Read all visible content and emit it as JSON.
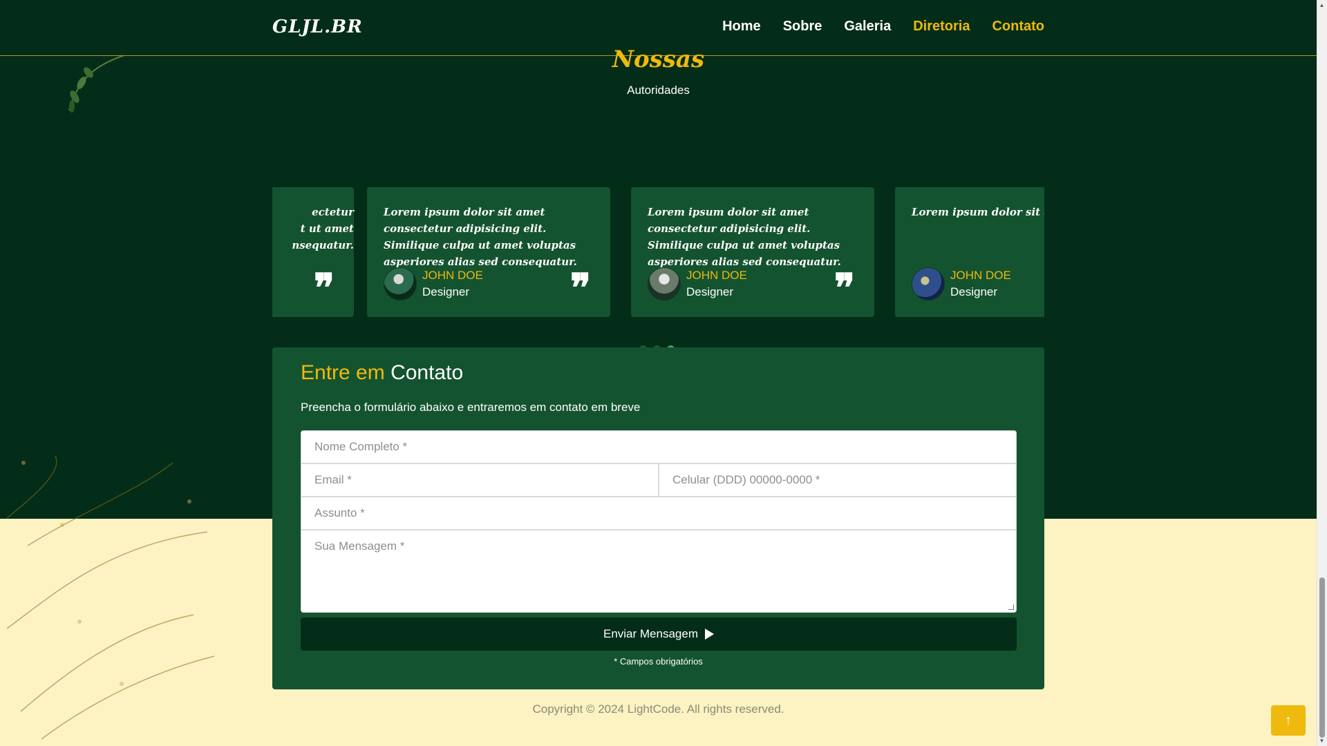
{
  "brand": "GLJL.BR",
  "nav": {
    "items": [
      {
        "label": "Home"
      },
      {
        "label": "Sobre"
      },
      {
        "label": "Galeria"
      },
      {
        "label": "Diretoria"
      },
      {
        "label": "Contato"
      }
    ]
  },
  "authorities": {
    "title": "Nossas",
    "subtitle": "Autoridades"
  },
  "testimonials": [
    {
      "quote_partial": "ectetur\nt ut amet\nnsequatur.",
      "name": "",
      "role": ""
    },
    {
      "quote": "Lorem ipsum dolor sit amet consectetur adipisicing elit. Similique culpa ut amet voluptas asperiores alias sed consequatur.",
      "name": "JOHN DOE",
      "role": "Designer",
      "quote_mark": "❞"
    },
    {
      "quote": "Lorem ipsum dolor sit amet consectetur adipisicing elit. Similique culpa ut amet voluptas asperiores alias sed consequatur.",
      "name": "JOHN DOE",
      "role": "Designer",
      "quote_mark": "❞"
    },
    {
      "quote": "Lorem ipsum dolor sit amet consectetur adipisicing elit. Similique culpa ut amet voluptas asperiores alias sed consequatur.",
      "name": "JOHN DOE",
      "role": "Designer",
      "quote_mark": "❞"
    }
  ],
  "carousel": {
    "active_dot": 3,
    "dot_count": 3
  },
  "contact": {
    "title_part1": "Entre em",
    "title_part2": "Contato",
    "description": "Preencha o formulário abaixo e entraremos em contato em breve",
    "placeholders": {
      "name": "Nome Completo *",
      "email": "Email *",
      "phone": "Celular (DDD) 00000-0000 *",
      "subject": "Assunto *",
      "message": "Sua Mensagem *"
    },
    "submit_label": "Enviar Mensagem",
    "required_note": "* Campos obrigatórios"
  },
  "footer": {
    "copyright": "Copyright © 2024 LightCode. All rights reserved."
  },
  "icons": {
    "quote": "quote-icon",
    "send": "send-arrow-icon",
    "to_top": "arrow-up-icon"
  },
  "colors": {
    "dark_green": "#032d18",
    "card_green": "#14532f",
    "accent_gold": "#f0b90d",
    "cream": "#fcf2c2"
  }
}
